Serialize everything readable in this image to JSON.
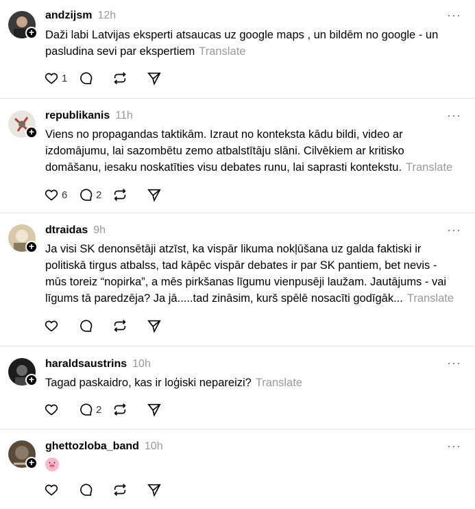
{
  "posts": [
    {
      "user": "andzijsm",
      "time": "12h",
      "text": "Daži labi Latvijas eksperti atsaucas uz google maps , un bildēm no google - un pasludina sevi par ekspertiem",
      "translate": "Translate",
      "likes": "1",
      "replies": ""
    },
    {
      "user": "republikanis",
      "time": "11h",
      "text": "Viens no propagandas taktikām. Izraut no konteksta kādu bildi, video ar izdomājumu, lai sazombētu zemo atbalstītāju slāni. Cilvēkiem ar kritisko domāšanu, iesaku noskatīties visu debates runu, lai saprasti kontekstu.",
      "translate": "Translate",
      "likes": "6",
      "replies": "2"
    },
    {
      "user": "dtraidas",
      "time": "9h",
      "text": "Ja visi SK denonsētāji atzīst, ka vispār likuma nokļūšana uz galda faktiski ir politiskā tirgus atbalss, tad kāpēc vispār debates ir par SK pantiem, bet nevis - mūs toreiz “nopirka”, a mēs pirkšanas līgumu vienpusēji laužam. Jautājums - vai līgums tā paredzēja? Ja jā.....tad zināsim, kurš spēlē nosacīti godīgāk...",
      "translate": "Translate",
      "likes": "",
      "replies": ""
    },
    {
      "user": "haraldsaustrins",
      "time": "10h",
      "text": "Tagad paskaidro, kas ir loģiski nepareizi?",
      "translate": "Translate",
      "likes": "",
      "replies": "2"
    },
    {
      "user": "ghettozloba_band",
      "time": "10h",
      "text": "",
      "translate": "",
      "likes": "",
      "replies": ""
    }
  ],
  "more_glyph": "···",
  "plus_glyph": "+"
}
